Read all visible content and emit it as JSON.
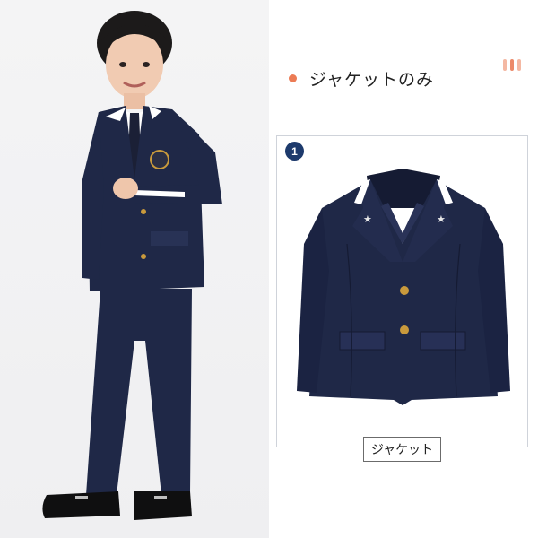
{
  "heading": {
    "title": "ジャケットのみ",
    "dot_color": "#ec7b55"
  },
  "decoration": {
    "bar_colors": [
      "#f4b8a3",
      "#ec8a6a",
      "#f4b8a3"
    ]
  },
  "product_panel": {
    "badge_number": "1",
    "badge_color": "#1d3a6c",
    "caption": "ジャケット"
  },
  "colors": {
    "navy": "#1f2847",
    "trim": "#ffffff",
    "button_gold": "#c99a3c"
  }
}
